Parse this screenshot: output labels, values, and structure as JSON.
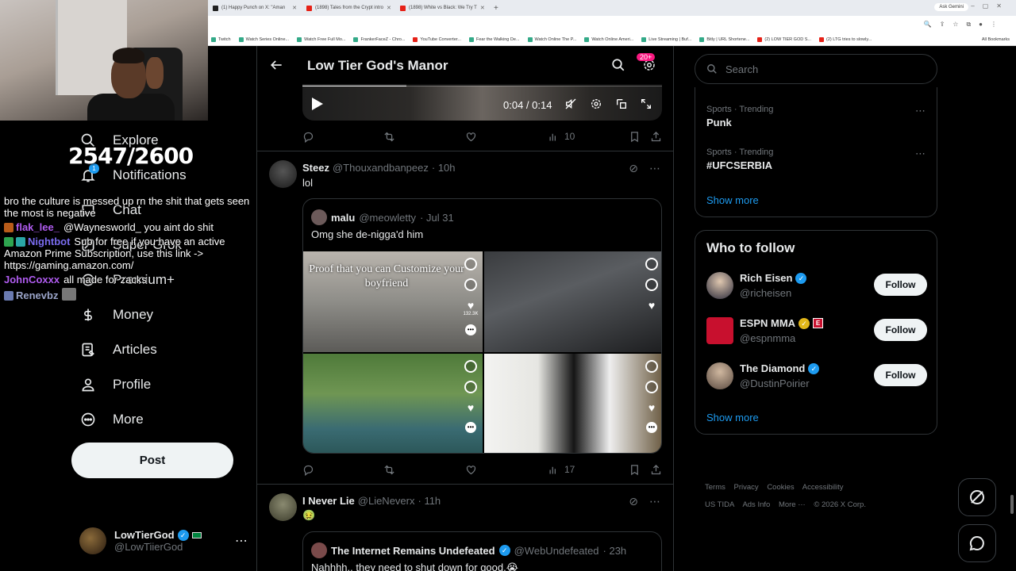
{
  "browser": {
    "tabs": [
      {
        "label": "(1) Happy Punch on X: \"Aman",
        "icon": "x-icon"
      },
      {
        "label": "(1898) Tales from the Crypt intro",
        "icon": "youtube-icon"
      },
      {
        "label": "(1898) White vs Black: We Try T",
        "icon": "youtube-icon"
      }
    ],
    "new_tab": "+",
    "ask_gemini": "Ask Gemini",
    "bookmarks": [
      "Twitch",
      "Watch Series Online...",
      "Watch Free Full Mo...",
      "FrankerFaceZ - Chro...",
      "YouTube Converter...",
      "Fear the Walking De...",
      "Watch Online The P...",
      "Watch Online Ameri...",
      "Live Streaming | Buf...",
      "Bitly | URL Shortene...",
      "(2) LOW TIER GOD S...",
      "(2) LTG tries to slowly..."
    ],
    "all_bookmarks": "All Bookmarks"
  },
  "overlay": {
    "counter": "2547/2600",
    "chat": [
      {
        "user": "",
        "text": "bro the culture is messed up rn the shit that gets seen the most is negative",
        "color": "#ffffff"
      },
      {
        "user": "flak_lee_",
        "text": "@Waynesworld_ you aint do shit",
        "color": "#b05cf0"
      },
      {
        "user": "Nightbot",
        "text": "Sub for free if you have an active Amazon Prime Subscription, use this link -> https://gaming.amazon.com/",
        "color": "#7a6cf0"
      },
      {
        "user": "JohnCoxxx",
        "text": "all made for zacks",
        "color": "#b05cf0"
      },
      {
        "user": "Renevbz",
        "text": "",
        "color": "#9aa4c8"
      }
    ]
  },
  "nav": {
    "items": [
      {
        "label": "Explore",
        "icon": "search-icon"
      },
      {
        "label": "Notifications",
        "icon": "bell-icon"
      },
      {
        "label": "Chat",
        "icon": "chat-icon"
      },
      {
        "label": "Super Grok",
        "icon": "grok-icon"
      },
      {
        "label": "Premium+",
        "icon": "premium-icon"
      },
      {
        "label": "Money",
        "icon": "money-icon"
      },
      {
        "label": "Articles",
        "icon": "articles-icon"
      },
      {
        "label": "Profile",
        "icon": "profile-icon"
      },
      {
        "label": "More",
        "icon": "more-icon"
      }
    ],
    "notifications_badge": "1",
    "post_label": "Post",
    "account": {
      "name": "LowTierGod",
      "handle": "@LowTiierGod",
      "more": "⋯"
    }
  },
  "main": {
    "title": "Low Tier God's Manor",
    "settings_badge": "20+",
    "video": {
      "time": "0:04 / 0:14",
      "progress": 0.29
    },
    "tweets": [
      {
        "views": "10"
      },
      {
        "name": "Steez",
        "handle": "@Thouxandbanpeez",
        "time": "· 10h",
        "text": "lol",
        "quote": {
          "name": "malu",
          "handle": "@meowletty",
          "time": "· Jul 31",
          "text": "Omg she de-nigga'd him",
          "caption": "Proof that you can Customize your boyfriend",
          "likes": "132.3K"
        },
        "views": "17"
      },
      {
        "name": "I Never Lie",
        "handle": "@LieNeverx",
        "time": "· 11h",
        "text": "🤢",
        "quote": {
          "name": "The Internet Remains Undefeated",
          "handle": "@WebUndefeated",
          "time": "· 23h",
          "text": "Nahhhh.. they need to shut down for good.😭"
        }
      }
    ]
  },
  "right": {
    "search_placeholder": "Search",
    "trends": [
      {
        "meta": "Sports · Trending",
        "topic": "Punk"
      },
      {
        "meta": "Sports · Trending",
        "topic": "#UFCSERBIA"
      }
    ],
    "show_more": "Show more",
    "who_to_follow": "Who to follow",
    "follow": [
      {
        "name": "Rich Eisen",
        "handle": "@richeisen",
        "badge": "blue"
      },
      {
        "name": "ESPN MMA",
        "handle": "@espnmma",
        "badge": "gold"
      },
      {
        "name": "The Diamond",
        "handle": "@DustinPoirier",
        "badge": "blue"
      }
    ],
    "follow_label": "Follow",
    "footer": [
      "Terms",
      "Privacy",
      "Cookies",
      "Accessibility",
      "US TIDA",
      "Ads Info",
      "More ···",
      "© 2026 X Corp."
    ]
  }
}
